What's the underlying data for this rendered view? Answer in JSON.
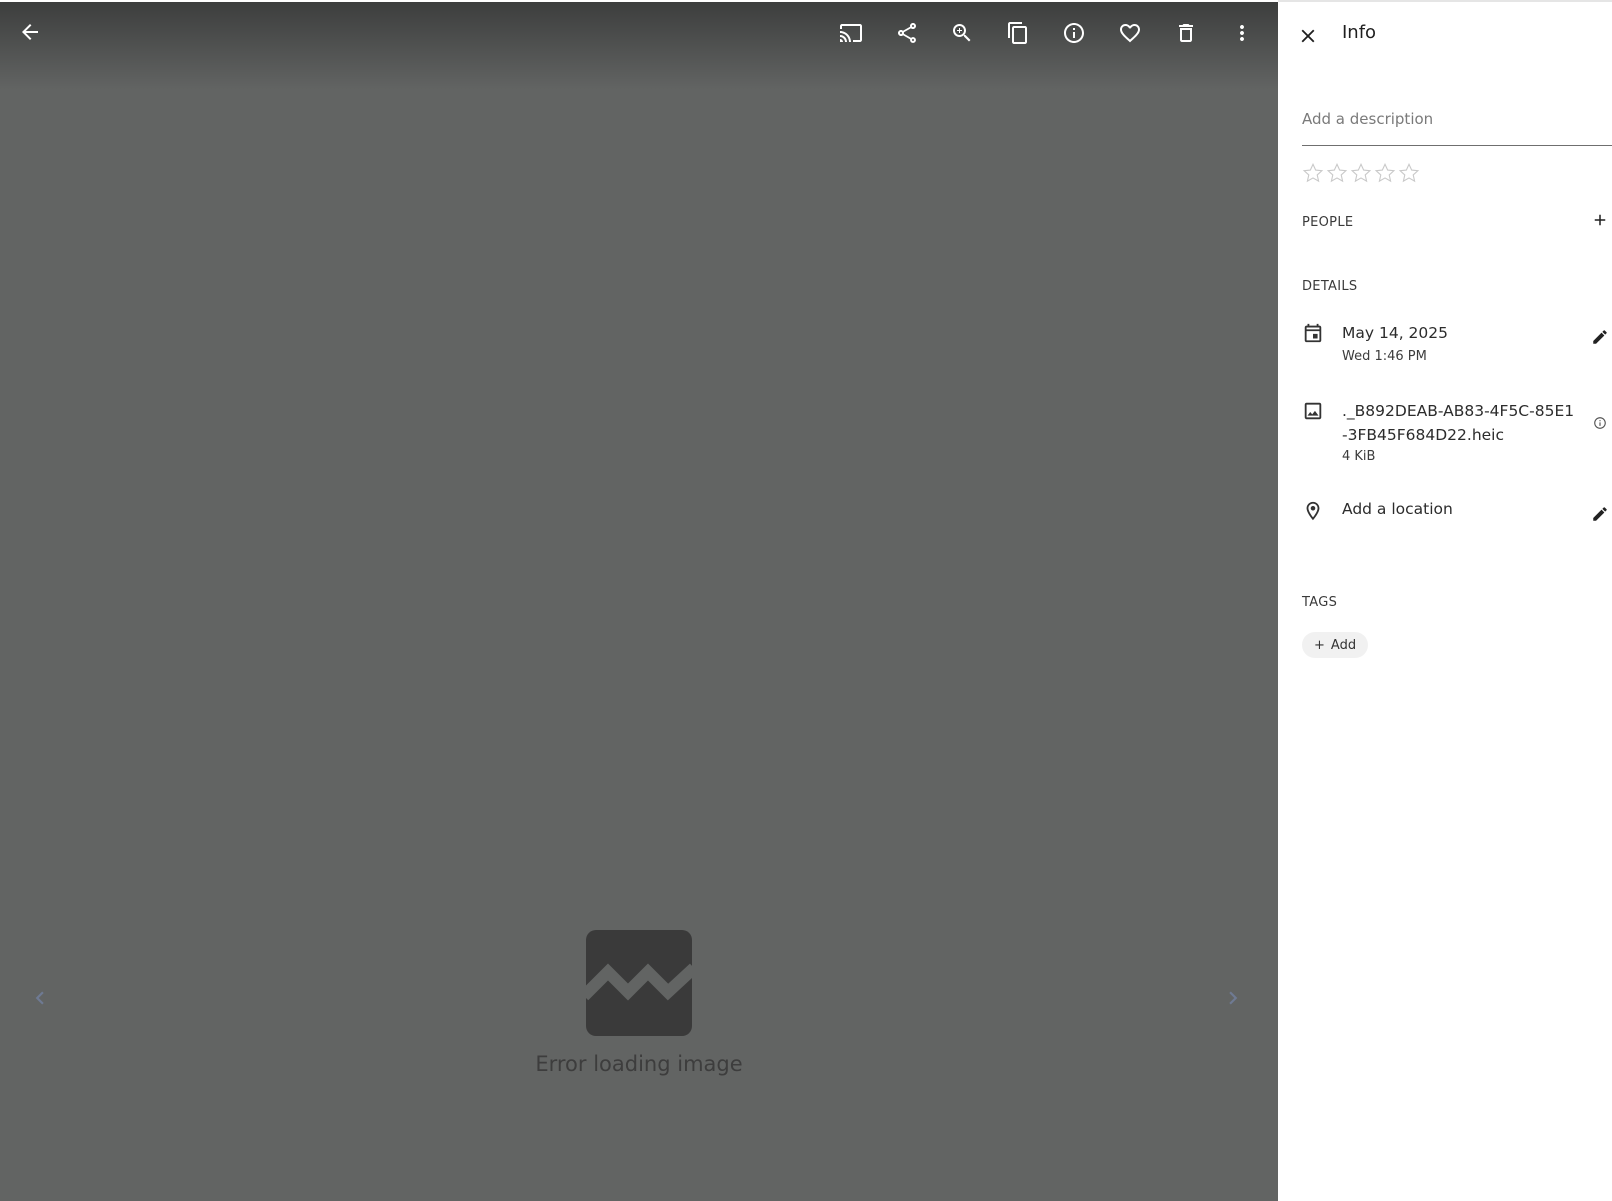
{
  "toolbar": {
    "back_icon": "arrow-back-icon",
    "actions": [
      {
        "name": "cast-button",
        "icon": "cast-icon"
      },
      {
        "name": "share-button",
        "icon": "share-icon"
      },
      {
        "name": "zoom-button",
        "icon": "zoom-in-icon"
      },
      {
        "name": "copy-button",
        "icon": "copy-icon"
      },
      {
        "name": "info-button",
        "icon": "info-icon"
      },
      {
        "name": "favorite-button",
        "icon": "heart-icon"
      },
      {
        "name": "delete-button",
        "icon": "trash-icon"
      },
      {
        "name": "more-button",
        "icon": "more-vert-icon"
      }
    ]
  },
  "viewer": {
    "error_text": "Error loading image",
    "prev_icon": "chevron-left-icon",
    "next_icon": "chevron-right-icon"
  },
  "panel": {
    "title": "Info",
    "description_placeholder": "Add a description",
    "rating": {
      "value": 0,
      "max": 5
    },
    "people_label": "PEOPLE",
    "details_label": "DETAILS",
    "date": {
      "primary": "May 14, 2025",
      "secondary": "Wed 1:46 PM"
    },
    "file": {
      "name": "._B892DEAB-AB83-4F5C-85E1-3FB45F684D22.heic",
      "size": "4 KiB"
    },
    "location": {
      "primary": "Add a location"
    },
    "tags_label": "TAGS",
    "add_tag_label": "Add"
  },
  "colors": {
    "viewer_bg": "#626463",
    "panel_bg": "#ffffff",
    "nav_arrow": "#6f7a93",
    "error_icon": "#3a3a3a"
  }
}
